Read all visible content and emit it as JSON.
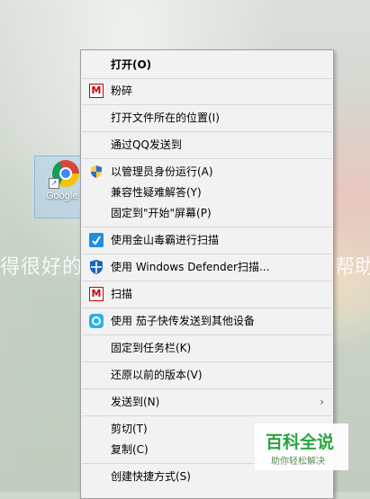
{
  "desktop": {
    "bg_text_left": "得很好的",
    "bg_text_right": "帮助",
    "icon_label": "Google Chrome"
  },
  "menu": {
    "items": [
      {
        "label": "打开(O)",
        "bold": true,
        "icon": null
      },
      {
        "label": "粉碎",
        "icon": "mcafee-icon"
      },
      {
        "label": "打开文件所在的位置(I)",
        "icon": null
      },
      {
        "label": "通过QQ发送到",
        "icon": null
      },
      {
        "label": "以管理员身份运行(A)",
        "icon": "uac-shield-icon"
      },
      {
        "label": "兼容性疑难解答(Y)",
        "icon": null
      },
      {
        "label": "固定到\"开始\"屏幕(P)",
        "icon": null
      },
      {
        "label": "使用金山毒霸进行扫描",
        "icon": "kingsoft-icon"
      },
      {
        "label": "使用 Windows Defender扫描...",
        "icon": "defender-icon"
      },
      {
        "label": "扫描",
        "icon": "mcafee-icon"
      },
      {
        "label": "使用 茄子快传发送到其他设备",
        "icon": "qiezi-icon"
      },
      {
        "label": "固定到任务栏(K)",
        "icon": null
      },
      {
        "label": "还原以前的版本(V)",
        "icon": null
      },
      {
        "label": "发送到(N)",
        "icon": null,
        "submenu_arrow": "›"
      },
      {
        "label": "剪切(T)",
        "icon": null
      },
      {
        "label": "复制(C)",
        "icon": null
      },
      {
        "label": "创建快捷方式(S)",
        "icon": null
      }
    ]
  },
  "watermark": {
    "title": "百科全说",
    "subtitle": "助你轻松解决"
  }
}
